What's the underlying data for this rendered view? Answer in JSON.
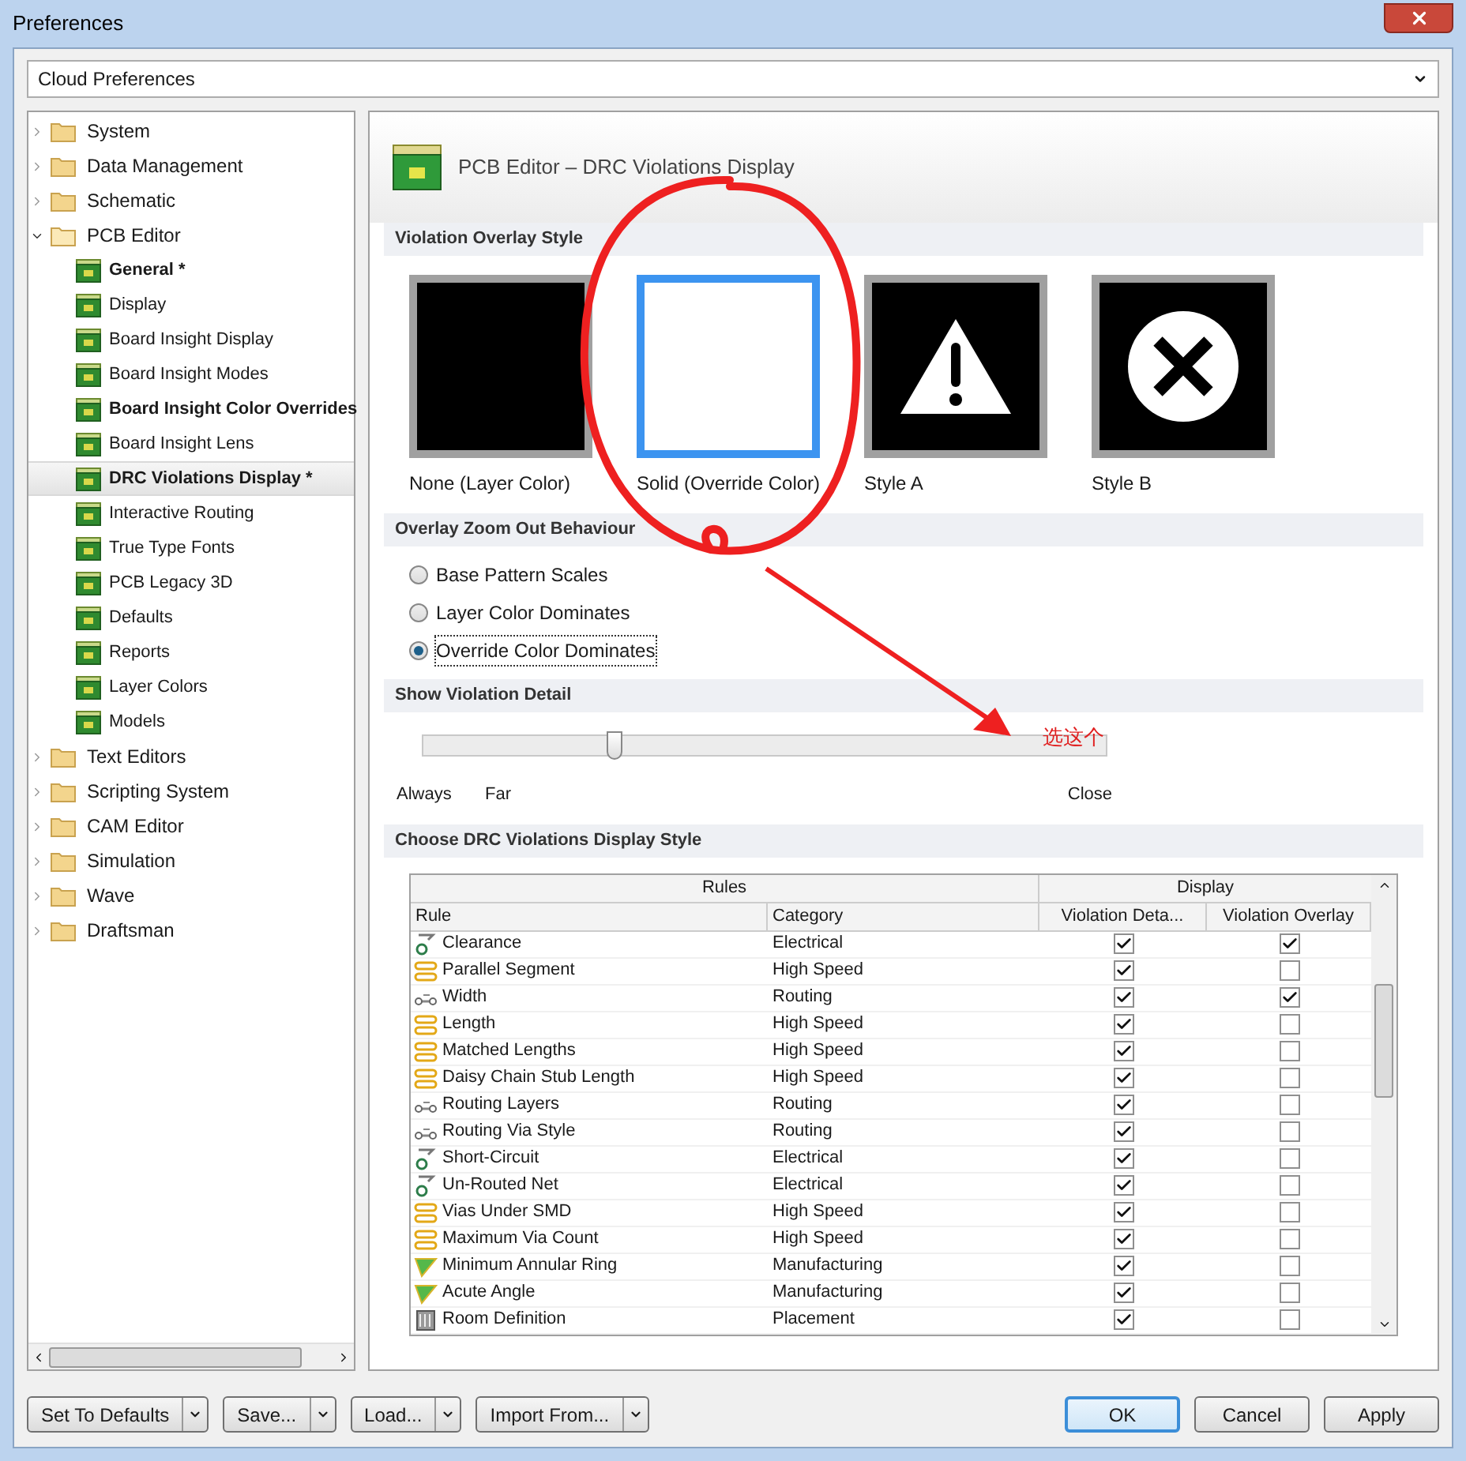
{
  "window": {
    "title": "Preferences"
  },
  "profile_dropdown": {
    "value": "Cloud Preferences"
  },
  "tree": [
    {
      "label": "System",
      "expanded": false,
      "bold": false,
      "selected": false
    },
    {
      "label": "Data Management",
      "expanded": false,
      "bold": false,
      "selected": false
    },
    {
      "label": "Schematic",
      "expanded": false,
      "bold": false,
      "selected": false
    },
    {
      "label": "PCB Editor",
      "expanded": true,
      "bold": false,
      "selected": false,
      "children": [
        {
          "label": "General *",
          "bold": true,
          "selected": false
        },
        {
          "label": "Display",
          "bold": false,
          "selected": false
        },
        {
          "label": "Board Insight Display",
          "bold": false,
          "selected": false
        },
        {
          "label": "Board Insight Modes",
          "bold": false,
          "selected": false
        },
        {
          "label": "Board Insight Color Overrides",
          "bold": true,
          "selected": false
        },
        {
          "label": "Board Insight Lens",
          "bold": false,
          "selected": false
        },
        {
          "label": "DRC Violations Display *",
          "bold": true,
          "selected": true
        },
        {
          "label": "Interactive Routing",
          "bold": false,
          "selected": false
        },
        {
          "label": "True Type Fonts",
          "bold": false,
          "selected": false
        },
        {
          "label": "PCB Legacy 3D",
          "bold": false,
          "selected": false
        },
        {
          "label": "Defaults",
          "bold": false,
          "selected": false
        },
        {
          "label": "Reports",
          "bold": false,
          "selected": false
        },
        {
          "label": "Layer Colors",
          "bold": false,
          "selected": false
        },
        {
          "label": "Models",
          "bold": false,
          "selected": false
        }
      ]
    },
    {
      "label": "Text Editors",
      "expanded": false,
      "bold": false,
      "selected": false
    },
    {
      "label": "Scripting System",
      "expanded": false,
      "bold": false,
      "selected": false
    },
    {
      "label": "CAM Editor",
      "expanded": false,
      "bold": false,
      "selected": false
    },
    {
      "label": "Simulation",
      "expanded": false,
      "bold": false,
      "selected": false
    },
    {
      "label": "Wave",
      "expanded": false,
      "bold": false,
      "selected": false
    },
    {
      "label": "Draftsman",
      "expanded": false,
      "bold": false,
      "selected": false
    }
  ],
  "page_title": "PCB Editor – DRC Violations Display",
  "overlay_style": {
    "heading": "Violation Overlay Style",
    "options": [
      {
        "kind": "none",
        "label": "None (Layer Color)",
        "selected": false
      },
      {
        "kind": "solid",
        "label": "Solid (Override Color)",
        "selected": true
      },
      {
        "kind": "warning",
        "label": "Style A",
        "selected": false
      },
      {
        "kind": "cross",
        "label": "Style B",
        "selected": false
      }
    ]
  },
  "zoom_out": {
    "heading": "Overlay Zoom Out Behaviour",
    "options": [
      {
        "label": "Base Pattern Scales",
        "selected": false
      },
      {
        "label": "Layer Color Dominates",
        "selected": false
      },
      {
        "label": "Override Color Dominates",
        "selected": true
      }
    ]
  },
  "violation_detail": {
    "heading": "Show Violation Detail",
    "level": 0.28,
    "labels": [
      "Always",
      "Far",
      "Close"
    ]
  },
  "display_style": {
    "heading": "Choose DRC Violations Display Style",
    "groups": [
      "Rules",
      "Display"
    ],
    "columns": [
      "Rule",
      "Category",
      "Violation Deta...",
      "Violation Overlay"
    ],
    "rows": [
      {
        "kind": "electrical",
        "rule": "Clearance",
        "category": "Electrical",
        "detail": true,
        "overlay": true
      },
      {
        "kind": "highspeed",
        "rule": "Parallel Segment",
        "category": "High Speed",
        "detail": true,
        "overlay": false
      },
      {
        "kind": "routing",
        "rule": "Width",
        "category": "Routing",
        "detail": true,
        "overlay": true
      },
      {
        "kind": "highspeed",
        "rule": "Length",
        "category": "High Speed",
        "detail": true,
        "overlay": false
      },
      {
        "kind": "highspeed",
        "rule": "Matched Lengths",
        "category": "High Speed",
        "detail": true,
        "overlay": false
      },
      {
        "kind": "highspeed",
        "rule": "Daisy Chain Stub Length",
        "category": "High Speed",
        "detail": true,
        "overlay": false
      },
      {
        "kind": "routing",
        "rule": "Routing Layers",
        "category": "Routing",
        "detail": true,
        "overlay": false
      },
      {
        "kind": "routing",
        "rule": "Routing Via Style",
        "category": "Routing",
        "detail": true,
        "overlay": false
      },
      {
        "kind": "electrical",
        "rule": "Short-Circuit",
        "category": "Electrical",
        "detail": true,
        "overlay": false
      },
      {
        "kind": "electrical",
        "rule": "Un-Routed Net",
        "category": "Electrical",
        "detail": true,
        "overlay": false
      },
      {
        "kind": "highspeed",
        "rule": "Vias Under SMD",
        "category": "High Speed",
        "detail": true,
        "overlay": false
      },
      {
        "kind": "highspeed",
        "rule": "Maximum Via Count",
        "category": "High Speed",
        "detail": true,
        "overlay": false
      },
      {
        "kind": "manufacturing",
        "rule": "Minimum Annular Ring",
        "category": "Manufacturing",
        "detail": true,
        "overlay": false
      },
      {
        "kind": "manufacturing",
        "rule": "Acute Angle",
        "category": "Manufacturing",
        "detail": true,
        "overlay": false
      },
      {
        "kind": "placement",
        "rule": "Room Definition",
        "category": "Placement",
        "detail": true,
        "overlay": false
      }
    ]
  },
  "left_buttons": [
    "Set To Defaults",
    "Save...",
    "Load...",
    "Import From..."
  ],
  "right_buttons": [
    {
      "label": "OK",
      "default": true
    },
    {
      "label": "Cancel",
      "default": false
    },
    {
      "label": "Apply",
      "default": false
    }
  ],
  "annotation": {
    "label": "选这个"
  }
}
